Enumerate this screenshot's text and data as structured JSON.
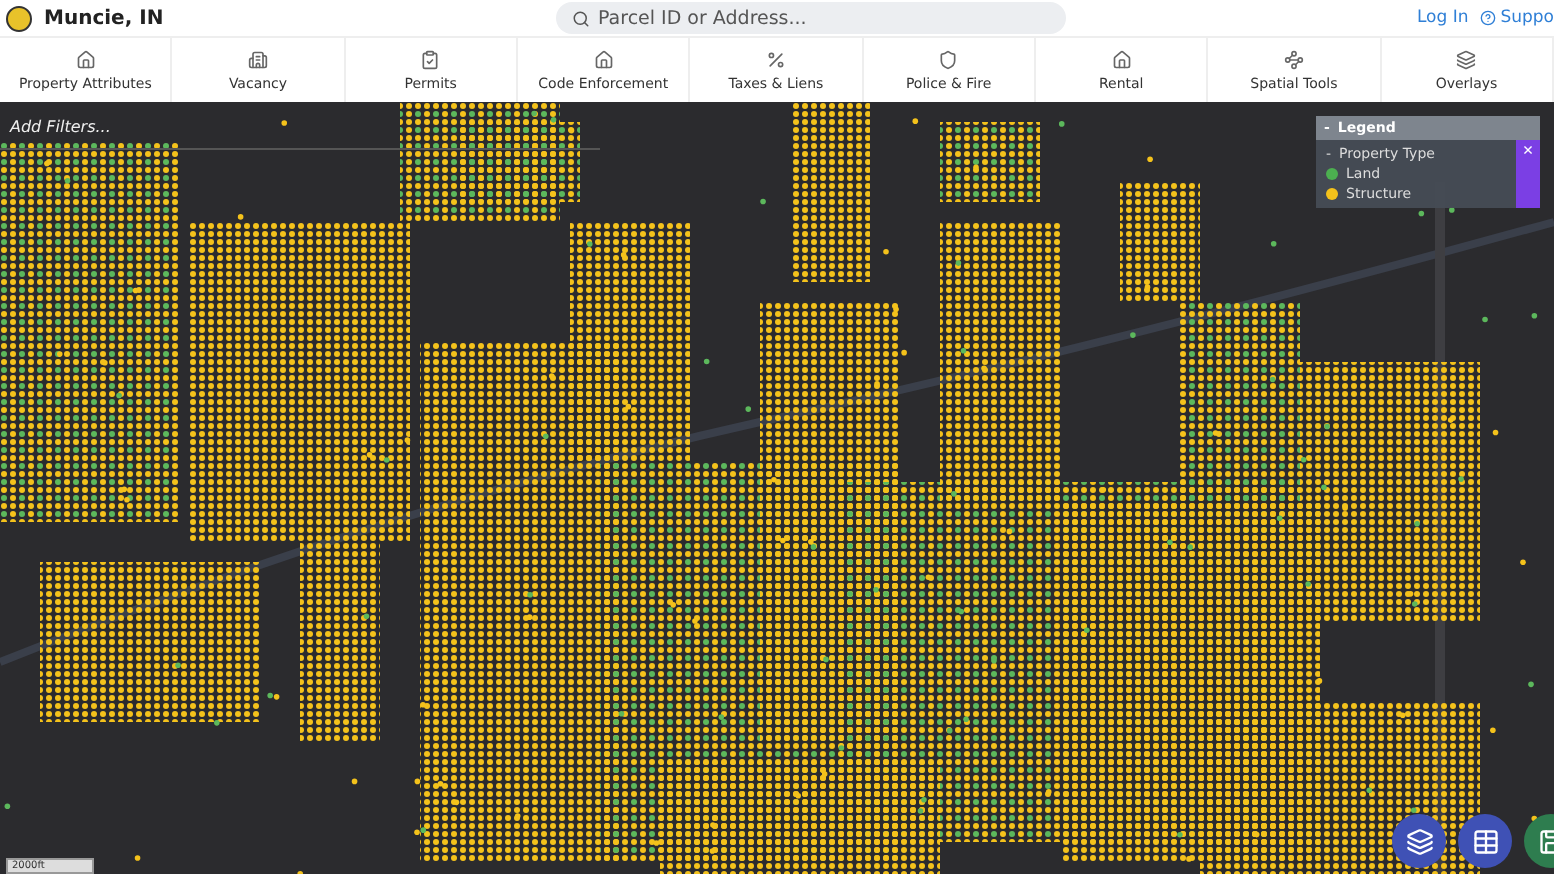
{
  "header": {
    "city": "Muncie, IN",
    "search": {
      "placeholder": "Parcel ID or Address..."
    },
    "login": "Log In",
    "support": "Suppo"
  },
  "nav": [
    {
      "label": "Property Attributes"
    },
    {
      "label": "Vacancy"
    },
    {
      "label": "Permits"
    },
    {
      "label": "Code Enforcement"
    },
    {
      "label": "Taxes & Liens"
    },
    {
      "label": "Police & Fire"
    },
    {
      "label": "Rental"
    },
    {
      "label": "Spatial Tools"
    },
    {
      "label": "Overlays"
    }
  ],
  "map": {
    "filters": "Add Filters...",
    "scale": "2000ft",
    "legend": {
      "title": "Legend",
      "collapse": "-",
      "group": {
        "toggle": "-",
        "title": "Property Type",
        "items": [
          {
            "label": "Land",
            "color": "#4caf50"
          },
          {
            "label": "Structure",
            "color": "#f4c21b"
          }
        ]
      },
      "close": "×"
    },
    "buttons": [
      {
        "kind": "layers",
        "color": "#3f51b5"
      },
      {
        "kind": "table",
        "color": "#3f51b5"
      },
      {
        "kind": "save",
        "color": "#2e7d4f"
      }
    ]
  }
}
